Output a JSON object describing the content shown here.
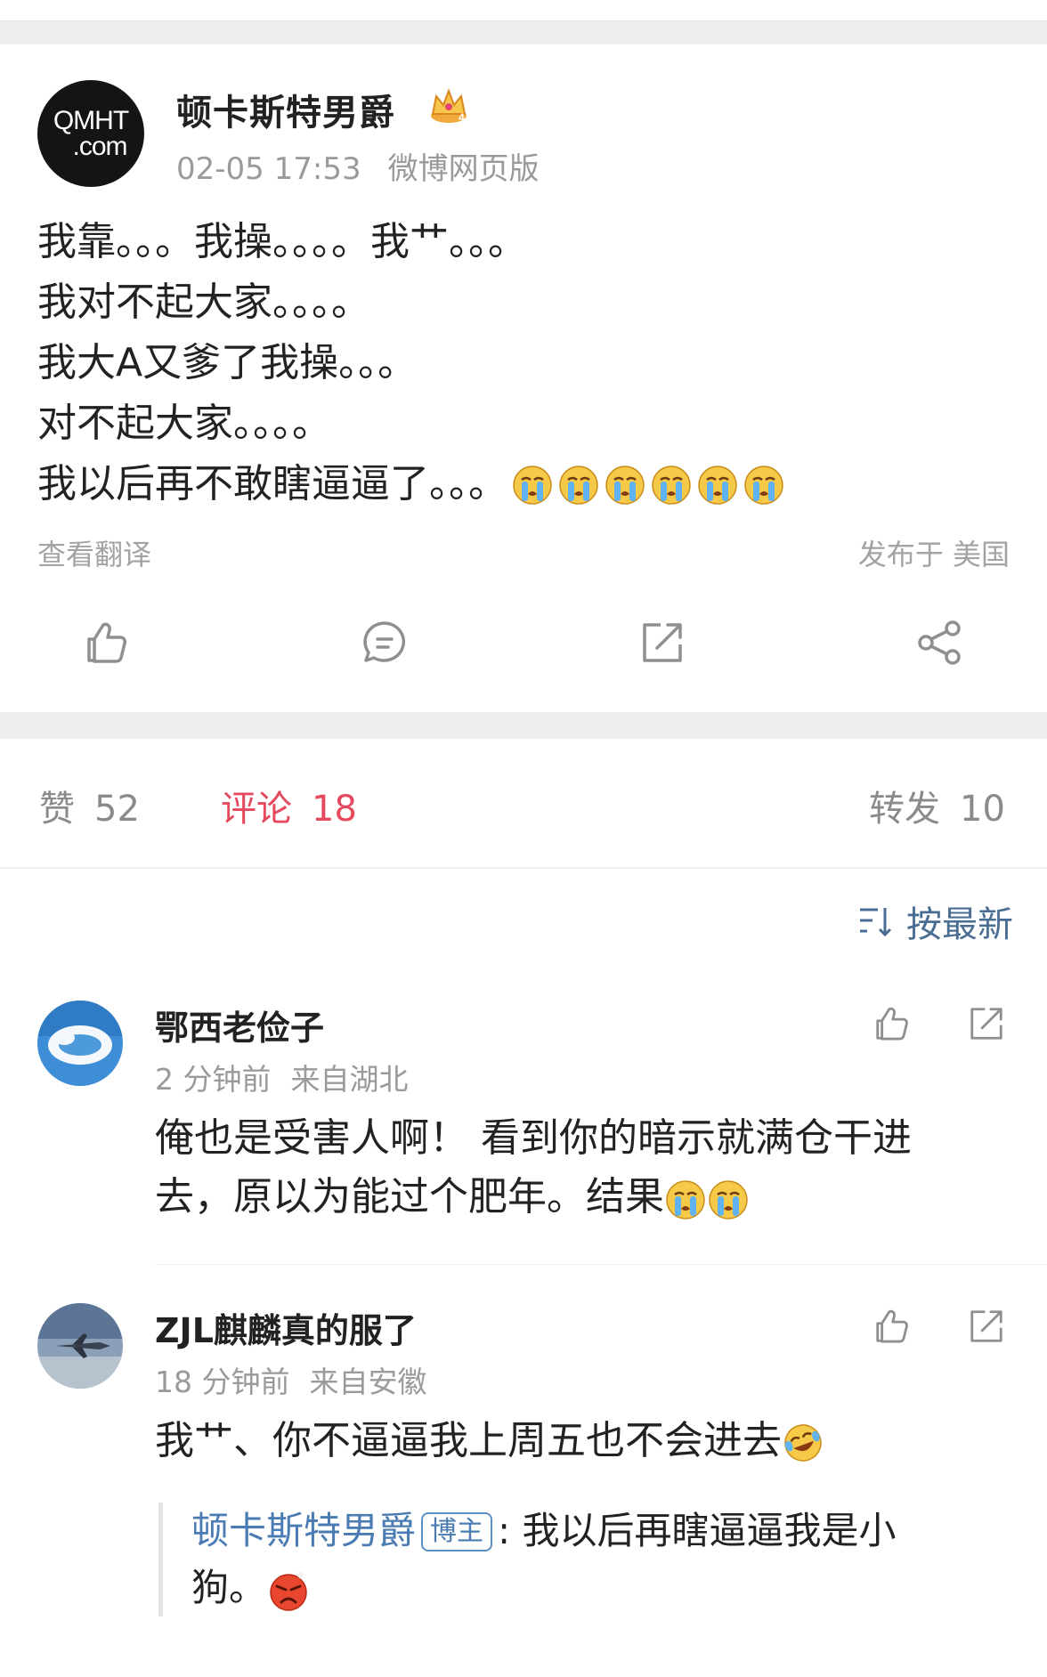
{
  "post": {
    "author": "顿卡斯特男爵",
    "avatar_text_line1": "QMHT",
    "avatar_text_line2": ".com",
    "time": "02-05 17:53",
    "source": "微博网页版",
    "lines": [
      "我靠。。。我操。。。。我艹。。。",
      "我对不起大家。。。。",
      "我大A又爹了我操。。。",
      "对不起大家。。。。",
      "我以后再不敢瞎逼逼了。。。"
    ],
    "translate_label": "查看翻译",
    "location": "发布于 美国",
    "actions": [
      "like-icon",
      "comment-icon",
      "repost-icon",
      "share-icon"
    ]
  },
  "stats": {
    "like_label": "赞",
    "like_count": "52",
    "comment_label": "评论",
    "comment_count": "18",
    "repost_label": "转发",
    "repost_count": "10"
  },
  "comments": {
    "sort_label": "按最新",
    "items": [
      {
        "name": "鄂西老俭子",
        "time": "2 分钟前",
        "location": "来自湖北",
        "text_line1": "俺也是受害人啊！ 看到你的暗示就满仓干进",
        "text_line2": "去，原以为能过个肥年。结果"
      },
      {
        "name": "ZJL麒麟真的服了",
        "time": "18 分钟前",
        "location": "来自安徽",
        "text": "我艹、你不逼逼我上周五也不会进去",
        "reply": {
          "name": "顿卡斯特男爵",
          "badge": "博主",
          "text_line1": ": 我以后再瞎逼逼我是小",
          "text_line2": "狗。"
        }
      }
    ]
  },
  "colors": {
    "accent_red": "#e5495e",
    "link_blue": "#4a7cb3",
    "muted": "#9a9a9a"
  }
}
